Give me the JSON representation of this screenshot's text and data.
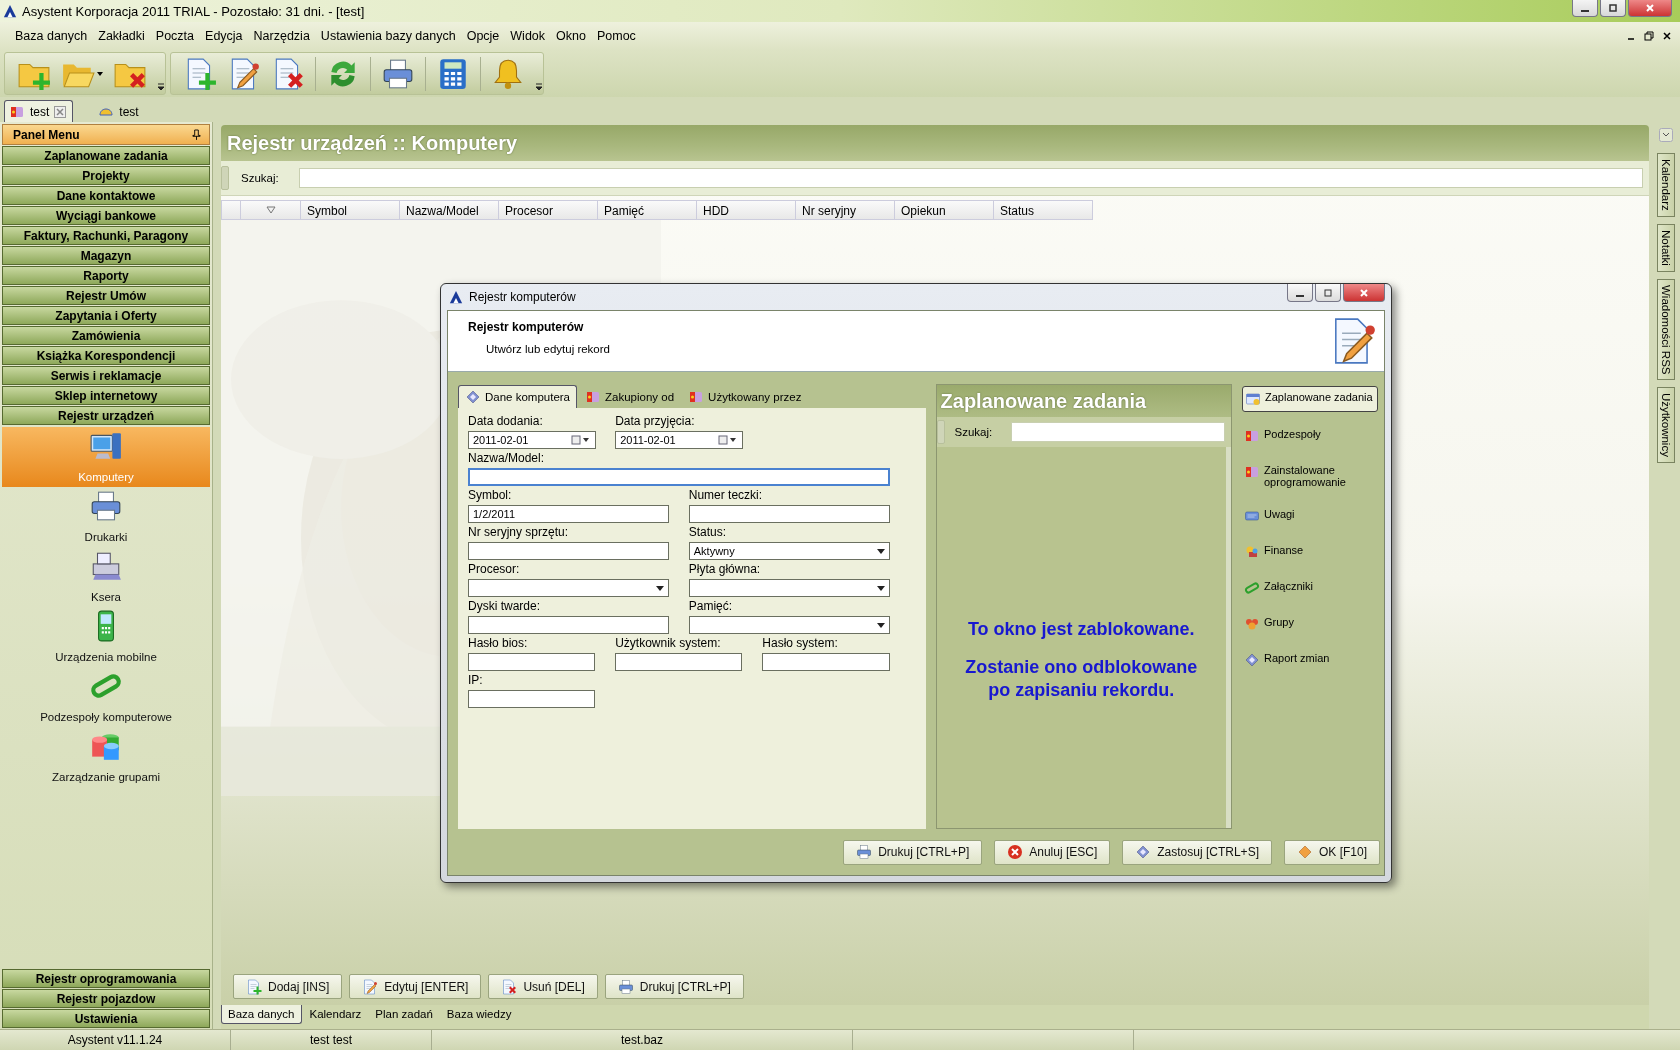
{
  "window": {
    "title": "Asystent Korporacja 2011 TRIAL - Pozostało: 31 dni. - [test]"
  },
  "menu": [
    "Baza danych",
    "Zakładki",
    "Poczta",
    "Edycja",
    "Narzędzia",
    "Ustawienia bazy danych",
    "Opcje",
    "Widok",
    "Okno",
    "Pomoc"
  ],
  "document_tabs": [
    {
      "label": "test",
      "selected": true
    },
    {
      "label": "test",
      "selected": false
    }
  ],
  "panel_menu": {
    "title": "Panel Menu",
    "sections": [
      {
        "label": "Zaplanowane zadania"
      },
      {
        "label": "Projekty"
      },
      {
        "label": "Dane kontaktowe"
      },
      {
        "label": "Wyciągi bankowe"
      },
      {
        "label": "Faktury, Rachunki, Paragony"
      },
      {
        "label": "Magazyn"
      },
      {
        "label": "Raporty"
      },
      {
        "label": "Rejestr Umów"
      },
      {
        "label": "Zapytania i Oferty"
      },
      {
        "label": "Zamówienia"
      },
      {
        "label": "Książka Korespondencji"
      },
      {
        "label": "Serwis i reklamacje"
      },
      {
        "label": "Sklep internetowy"
      },
      {
        "label": "Rejestr urządzeń",
        "items": [
          {
            "label": "Komputery",
            "selected": true
          },
          {
            "label": "Drukarki",
            "selected": false
          },
          {
            "label": "Ksera",
            "selected": false
          },
          {
            "label": "Urządzenia mobilne",
            "selected": false
          },
          {
            "label": "Podzespoły komputerowe",
            "selected": false
          },
          {
            "label": "Zarządzanie grupami",
            "selected": false
          }
        ]
      },
      {
        "label": "Rejestr oprogramowania"
      },
      {
        "label": "Rejestr pojazdow"
      },
      {
        "label": "Ustawienia"
      }
    ]
  },
  "content": {
    "title": "Rejestr urządzeń :: Komputery",
    "search_label": "Szukaj:",
    "columns": [
      "Symbol",
      "Nazwa/Model",
      "Procesor",
      "Pamięć",
      "HDD",
      "Nr seryjny",
      "Opiekun",
      "Status"
    ]
  },
  "side_tabs": [
    "Kalendarz",
    "Notatki",
    "Wiadomości RSS",
    "Użytkownicy"
  ],
  "actions": [
    "Dodaj [INS]",
    "Edytuj [ENTER]",
    "Usuń [DEL]",
    "Drukuj [CTRL+P]"
  ],
  "bottom_tabs": [
    {
      "label": "Baza danych",
      "selected": true
    },
    {
      "label": "Kalendarz",
      "selected": false
    },
    {
      "label": "Plan zadań",
      "selected": false
    },
    {
      "label": "Baza wiedzy",
      "selected": false
    }
  ],
  "status_bar": [
    "Asystent v11.1.24",
    "test test",
    "test.baz"
  ],
  "dialog": {
    "title": "Rejestr komputerów",
    "heading": "Rejestr komputerów",
    "subheading": "Utwórz lub edytuj rekord",
    "tabs": [
      {
        "label": "Dane komputera",
        "selected": true
      },
      {
        "label": "Zakupiony od",
        "selected": false
      },
      {
        "label": "Użytkowany przez",
        "selected": false
      }
    ],
    "form_rows": [
      [
        {
          "label": "Data dodania:",
          "kind": "date",
          "value": "2011-02-01",
          "focused": false
        },
        {
          "label": "Data przyjęcia:",
          "kind": "date",
          "value": "2011-02-01",
          "focused": false
        }
      ],
      [
        {
          "label": "Nazwa/Model:",
          "kind": "text",
          "focused": true
        }
      ],
      [
        {
          "label": "Symbol:",
          "kind": "text",
          "value": "1/2/2011",
          "focused": false
        },
        {
          "label": "Numer teczki:",
          "kind": "text",
          "focused": false
        }
      ],
      [
        {
          "label": "Nr seryjny sprzętu:",
          "kind": "text",
          "focused": false
        },
        {
          "label": "Status:",
          "kind": "select",
          "value": "Aktywny",
          "focused": false
        }
      ],
      [
        {
          "label": "Procesor:",
          "kind": "select",
          "focused": false
        },
        {
          "label": "Płyta główna:",
          "kind": "select",
          "focused": false
        }
      ],
      [
        {
          "label": "Dyski twarde:",
          "kind": "text",
          "focused": false
        },
        {
          "label": "Pamięć:",
          "kind": "select",
          "focused": false
        }
      ],
      [
        {
          "label": "Hasło bios:",
          "kind": "text",
          "focused": false
        },
        {
          "label": "Użytkownik system:",
          "kind": "text",
          "focused": false
        },
        {
          "label": "Hasło system:",
          "kind": "text",
          "focused": false
        }
      ],
      [
        {
          "label": "IP:",
          "kind": "text",
          "focused": false
        }
      ]
    ],
    "panel": {
      "title": "Zaplanowane zadania",
      "search_label": "Szukaj:",
      "message": [
        "To okno jest zablokowane.",
        "Zostanie ono odblokowane po zapisaniu rekordu."
      ]
    },
    "nav": [
      {
        "label": "Zaplanowane zadania",
        "selected": true
      },
      {
        "label": "Podzespoły",
        "selected": false
      },
      {
        "label": "Zainstalowane oprogramowanie",
        "selected": false
      },
      {
        "label": "Uwagi",
        "selected": false
      },
      {
        "label": "Finanse",
        "selected": false
      },
      {
        "label": "Załączniki",
        "selected": false
      },
      {
        "label": "Grupy",
        "selected": false
      },
      {
        "label": "Raport zmian",
        "selected": false
      }
    ],
    "buttons": [
      "Drukuj [CTRL+P]",
      "Anuluj [ESC]",
      "Zastosuj [CTRL+S]",
      "OK [F10]"
    ]
  }
}
